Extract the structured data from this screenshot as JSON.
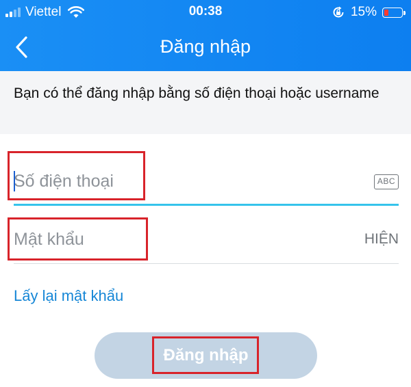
{
  "status_bar": {
    "carrier": "Viettel",
    "time": "00:38",
    "battery_percent": "15%",
    "battery_level": 0.15,
    "battery_color": "#ff3b30",
    "icons": [
      "signal-icon",
      "wifi-icon",
      "rotation-lock-icon",
      "battery-icon"
    ]
  },
  "nav": {
    "title": "Đăng nhập",
    "back_icon": "chevron-left-icon",
    "color": "#1a8ff5"
  },
  "info_text": "Bạn có thể đăng nhập bằng số điện thoại hoặc username",
  "form": {
    "phone": {
      "placeholder": "Số điện thoại",
      "value": "",
      "keyboard_badge": "ABC",
      "underline_color": "#35c3eb"
    },
    "password": {
      "placeholder": "Mật khẩu",
      "value": "",
      "toggle_label": "HIỆN"
    },
    "forgot_link": "Lấy lại mật khẩu",
    "forgot_color": "#1586d6",
    "submit_label": "Đăng nhập",
    "submit_color": "#c3d4e4"
  },
  "highlight_color": "#d8232a"
}
